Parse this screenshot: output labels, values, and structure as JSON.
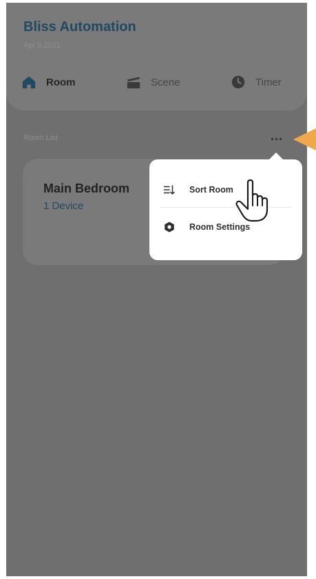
{
  "app": {
    "title": "Bliss Automation",
    "date": "Apr 9,2021"
  },
  "tabs": [
    {
      "label": "Room",
      "icon": "home-icon",
      "active": true
    },
    {
      "label": "Scene",
      "icon": "clapperboard-icon",
      "active": false
    },
    {
      "label": "Timer",
      "icon": "clock-icon",
      "active": false
    }
  ],
  "room_list": {
    "label": "Room List",
    "more_icon": "more-horizontal-icon"
  },
  "rooms": [
    {
      "name": "Main Bedroom",
      "devices": "1 Device"
    }
  ],
  "menu": {
    "items": [
      {
        "label": "Sort Room",
        "icon": "sort-icon"
      },
      {
        "label": "Room Settings",
        "icon": "hexagon-settings-icon"
      }
    ]
  },
  "colors": {
    "accent": "#1e4a63",
    "overlay": "#6f6f6f",
    "callout": "#f0a94a"
  }
}
